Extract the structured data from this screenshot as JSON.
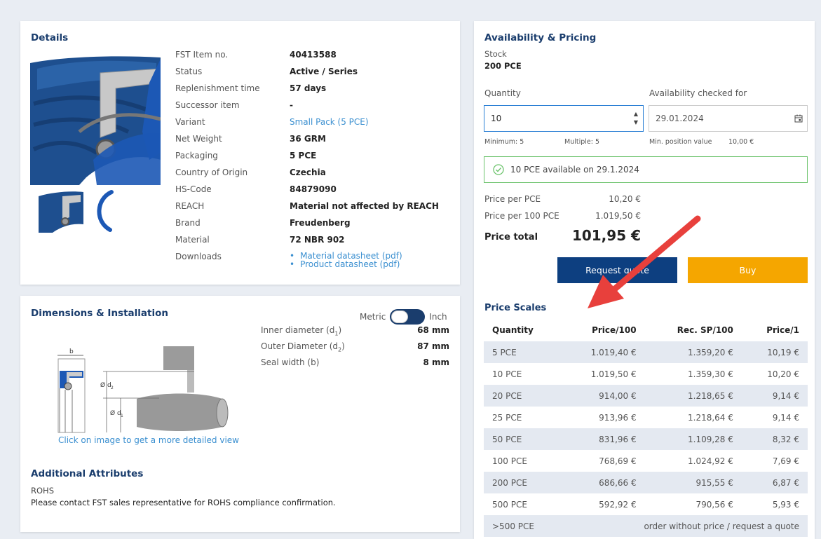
{
  "details": {
    "title": "Details",
    "rows": [
      {
        "label": "FST Item no.",
        "value": "40413588"
      },
      {
        "label": "Status",
        "value": "Active / Series"
      },
      {
        "label": "Replenishment time",
        "value": "57 days"
      },
      {
        "label": "Successor item",
        "value": "-"
      },
      {
        "label": "Variant",
        "value": "Small Pack (5 PCE)"
      },
      {
        "label": "Net Weight",
        "value": "36 GRM"
      },
      {
        "label": "Packaging",
        "value": "5 PCE"
      },
      {
        "label": "Country of Origin",
        "value": "Czechia"
      },
      {
        "label": "HS-Code",
        "value": "84879090"
      },
      {
        "label": "REACH",
        "value": "Material not affected by REACH"
      },
      {
        "label": "Brand",
        "value": "Freudenberg"
      },
      {
        "label": "Material",
        "value": "72 NBR 902"
      },
      {
        "label": "Downloads",
        "value": ""
      }
    ],
    "downloads": [
      "Material datasheet (pdf)",
      "Product datasheet (pdf)"
    ]
  },
  "dimensions": {
    "title": "Dimensions & Installation",
    "unit_left": "Metric",
    "unit_right": "Inch",
    "rows": [
      {
        "label": "Inner diameter (d",
        "sub": "1",
        "tail": ")",
        "value": "68 mm"
      },
      {
        "label": "Outer Diameter (d",
        "sub": "2",
        "tail": ")",
        "value": "87 mm"
      },
      {
        "label": "Seal width (b)",
        "sub": "",
        "tail": "",
        "value": "8 mm"
      }
    ],
    "drawing_labels": {
      "b": "b",
      "d2": "Ø d",
      "d2sub": "2",
      "d1": "Ø d",
      "d1sub": "1"
    },
    "image_hint": "Click on image to get a more detailed view"
  },
  "additional": {
    "title": "Additional Attributes",
    "rohs_label": "ROHS",
    "rohs_text": "Please contact FST sales representative for ROHS compliance confirmation."
  },
  "pricing": {
    "title": "Availability & Pricing",
    "stock_label": "Stock",
    "stock_value": "200 PCE",
    "quantity_label": "Quantity",
    "quantity_value": "10",
    "date_label": "Availability checked for",
    "date_value": "29.01.2024",
    "minimum": "Minimum: 5",
    "multiple": "Multiple: 5",
    "min_position_label": "Min. position value",
    "min_position_value": "10,00 €",
    "availability_msg": "10 PCE available on 29.1.2024",
    "price_per_pce_label": "Price per PCE",
    "price_per_pce": "10,20 €",
    "price_per_100_label": "Price per 100 PCE",
    "price_per_100": "1.019,50 €",
    "total_label": "Price total",
    "total_value": "101,95 €",
    "request_quote": "Request quote",
    "buy": "Buy",
    "accent_blue": "#0d3f80",
    "accent_orange": "#f5a600",
    "success_green": "#6cc36c"
  },
  "scales": {
    "title": "Price Scales",
    "headers": [
      "Quantity",
      "Price/100",
      "Rec. SP/100",
      "Price/1"
    ],
    "rows": [
      [
        "5 PCE",
        "1.019,40 €",
        "1.359,20 €",
        "10,19 €"
      ],
      [
        "10 PCE",
        "1.019,50 €",
        "1.359,30 €",
        "10,20 €"
      ],
      [
        "20 PCE",
        "914,00 €",
        "1.218,65 €",
        "9,14 €"
      ],
      [
        "25 PCE",
        "913,96 €",
        "1.218,64 €",
        "9,14 €"
      ],
      [
        "50 PCE",
        "831,96 €",
        "1.109,28 €",
        "8,32 €"
      ],
      [
        "100 PCE",
        "768,69 €",
        "1.024,92 €",
        "7,69 €"
      ],
      [
        "200 PCE",
        "686,66 €",
        "915,55 €",
        "6,87 €"
      ],
      [
        "500 PCE",
        "592,92 €",
        "790,56 €",
        "5,93 €"
      ]
    ],
    "last_row_qty": ">500 PCE",
    "last_row_note": "order without price / request a quote"
  }
}
